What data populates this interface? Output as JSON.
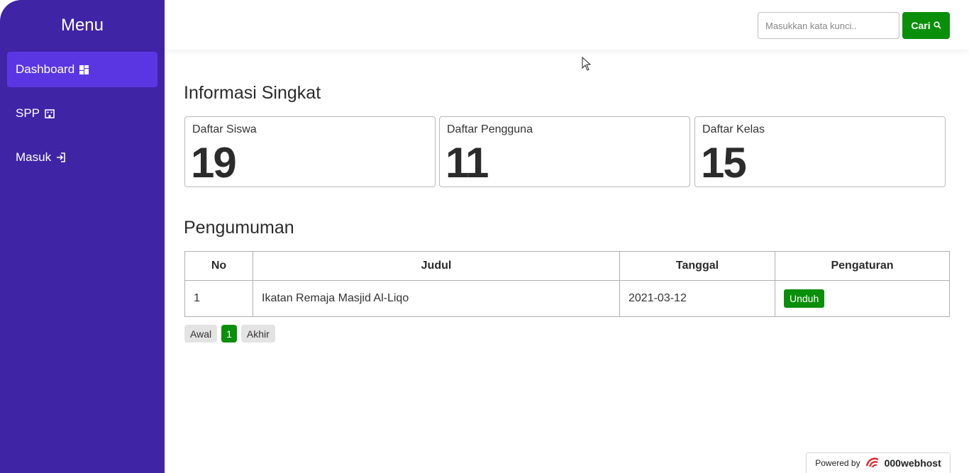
{
  "sidebar": {
    "title": "Menu",
    "items": [
      {
        "label": "Dashboard",
        "icon": "dashboard-icon",
        "active": true
      },
      {
        "label": "SPP",
        "icon": "building-icon",
        "active": false
      },
      {
        "label": "Masuk",
        "icon": "login-icon",
        "active": false
      }
    ]
  },
  "search": {
    "placeholder": "Masukkan kata kunci..",
    "button_label": "Cari"
  },
  "info": {
    "title": "Informasi Singkat",
    "cards": [
      {
        "label": "Daftar Siswa",
        "value": "19"
      },
      {
        "label": "Daftar Pengguna",
        "value": "11"
      },
      {
        "label": "Daftar Kelas",
        "value": "15"
      }
    ]
  },
  "announcements": {
    "title": "Pengumuman",
    "columns": [
      "No",
      "Judul",
      "Tanggal",
      "Pengaturan"
    ],
    "rows": [
      {
        "no": "1",
        "judul": "Ikatan Remaja Masjid Al-Liqo",
        "tanggal": "2021-03-12",
        "action": "Unduh"
      }
    ],
    "pagination": {
      "first": "Awal",
      "current": "1",
      "last": "Akhir"
    }
  },
  "footer": {
    "powered_by": "Powered by",
    "brand": "000webhost"
  },
  "colors": {
    "sidebar_bg": "#4024a6",
    "active_item": "#5a36e3",
    "accent_green": "#0a8f0a"
  }
}
